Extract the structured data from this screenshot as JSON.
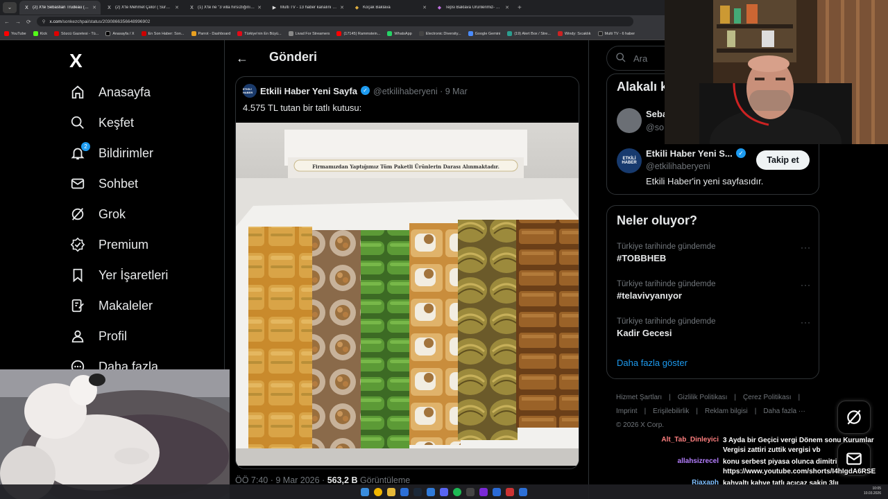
{
  "browser": {
    "tabs": [
      {
        "icon": "X",
        "title": "(2) X'te Sebastian Trudeau (Yeni...",
        "active": true
      },
      {
        "icon": "X",
        "title": "(2) X'te Mehmet Çelor ( SürMe...",
        "active": false
      },
      {
        "icon": "X",
        "title": "(1) X'te ne \"3 villa hırsızlığını, S...",
        "active": false
      },
      {
        "icon": "▶",
        "title": "Multi TV - 13 haber kanalını ay...",
        "active": false
      },
      {
        "icon": "◆",
        "title": "Koçak Baklava",
        "active": false
      },
      {
        "icon": "◆",
        "title": "Tepsi Baklava Ürünlerimiz- Ha...",
        "active": false
      }
    ],
    "url_domain": "x.com",
    "url_path": "/sonkezchpai/status/2030866356648996902",
    "bookmarks": [
      "YouTube",
      "Kick",
      "Sözcü Gazetesi - Tü...",
      "Anasayfa / X",
      "En Son Haber: Son...",
      "Parrot - Dashboard",
      "Türkiye'nin En Büyü...",
      "Livad For Streamers",
      "(17145) Rammstein...",
      "WhatsApp",
      "Electronic Diversity...",
      "Google Gemini",
      "(19) Alert Box / Stre...",
      "Windy: Sıcaklık",
      "Multi TV - 6 haber"
    ]
  },
  "colors": {
    "accent": "#1d9bf0",
    "background": "#000000",
    "border": "#2f3336",
    "muted": "#71767b",
    "text": "#e7e9ea"
  },
  "nav": {
    "logo": "X",
    "items": [
      {
        "label": "Anasayfa",
        "icon": "home-icon"
      },
      {
        "label": "Keşfet",
        "icon": "search-icon"
      },
      {
        "label": "Bildirimler",
        "icon": "bell-icon",
        "badge": "2"
      },
      {
        "label": "Sohbet",
        "icon": "mail-icon"
      },
      {
        "label": "Grok",
        "icon": "grok-icon"
      },
      {
        "label": "Premium",
        "icon": "premium-icon"
      },
      {
        "label": "Yer İşaretleri",
        "icon": "bookmark-icon"
      },
      {
        "label": "Makaleler",
        "icon": "article-icon"
      },
      {
        "label": "Profil",
        "icon": "profile-icon"
      },
      {
        "label": "Daha fazla",
        "icon": "more-icon"
      }
    ]
  },
  "main": {
    "title": "Gönderi",
    "quote": {
      "avatar_text": "ETKİLİ HABER",
      "name": "Etkili Haber Yeni Sayfa",
      "handle_date": "@etkilihaberyeni · 9 Mar",
      "text": "4.575 TL tutan bir tatlı kutusu:",
      "image_caption": "Firmamızdan Yaptığımız Tüm Paketli Ürünlerin Darası Alınmaktadır."
    },
    "meta_time": "ÖÖ 7:40 · 9 Mar 2026 · ",
    "meta_views": "563,2 B",
    "meta_views_label": " Görüntüleme"
  },
  "right": {
    "search_placeholder": "Ara",
    "related": {
      "title": "Alakalı k",
      "user1_name": "Seba",
      "user1_handle": "@so",
      "user2_avatar": "ETKİLİ HABER",
      "user2_name": "Etkili Haber Yeni S...",
      "user2_handle": "@etkilihaberyeni",
      "user2_bio": "Etkili Haber'in yeni sayfasıdır.",
      "follow_label": "Takip et"
    },
    "trends": {
      "title": "Neler oluyor?",
      "items": [
        {
          "context": "Türkiye tarihinde gündemde",
          "name": "#TOBBHEB"
        },
        {
          "context": "Türkiye tarihinde gündemde",
          "name": "#telavivyanıyor"
        },
        {
          "context": "Türkiye tarihinde gündemde",
          "name": "Kadir Gecesi"
        }
      ],
      "more_label": "···",
      "show_more": "Daha fazla göster"
    },
    "footer": {
      "links": [
        "Hizmet Şartları",
        "|",
        "Gizlilik Politikası",
        "|",
        "Çerez Politikası",
        "|",
        "Imprint",
        "|",
        "Erişilebilirlik",
        "|",
        "Reklam bilgisi",
        "|",
        "Daha fazla ···"
      ],
      "copyright": "© 2026 X Corp."
    }
  },
  "chat": [
    {
      "user": "Alt_Tab_Dinleyici",
      "color": "#ff7f7f",
      "msg": "3 Ayda bir Geçici vergi Dönem sonu Kurumlar Vergisi zattiri zuttik vergisi vb"
    },
    {
      "user": "allahsizrecel",
      "color": "#b57fff",
      "msg": "konu serbest piyasa olunca dimitri https://www.youtube.com/shorts/I4hIgdA6RSE"
    },
    {
      "user": "Riaxaph",
      "color": "#7fbfff",
      "msg": "kahvaltı kahve tatlı açıcaz sakin 3lıı"
    }
  ],
  "taskbar": {
    "time": "10:05",
    "date": "10.03.2026"
  }
}
